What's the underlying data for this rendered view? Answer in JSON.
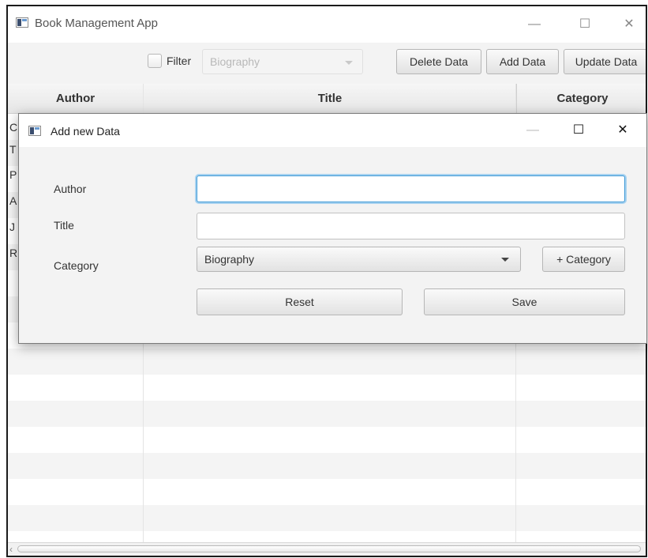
{
  "window": {
    "title": "Book Management App",
    "minimize_glyph": "—",
    "maximize_glyph": "☐",
    "close_glyph": "✕"
  },
  "toolbar": {
    "filter_label": "Filter",
    "filter_checked": false,
    "filter_category_value": "Biography",
    "delete_label": "Delete Data",
    "add_label": "Add Data",
    "update_label": "Update Data"
  },
  "table": {
    "columns": [
      "Author",
      "Title",
      "Category"
    ],
    "visible_first_letters": [
      "C",
      "T",
      "P",
      "A",
      "J",
      "R"
    ]
  },
  "dialog": {
    "title": "Add new Data",
    "minimize_glyph": "—",
    "maximize_glyph": "☐",
    "close_glyph": "✕",
    "author_label": "Author",
    "author_value": "",
    "title_label": "Title",
    "title_value": "",
    "category_label": "Category",
    "category_value": "Biography",
    "add_category_label": "+ Category",
    "reset_label": "Reset",
    "save_label": "Save"
  },
  "scrollbar": {
    "left_arrow": "‹"
  },
  "colors": {
    "focus_border": "#3f9ad6",
    "window_border": "#1b1b1b",
    "toolbar_bg": "#f3f3f3"
  }
}
